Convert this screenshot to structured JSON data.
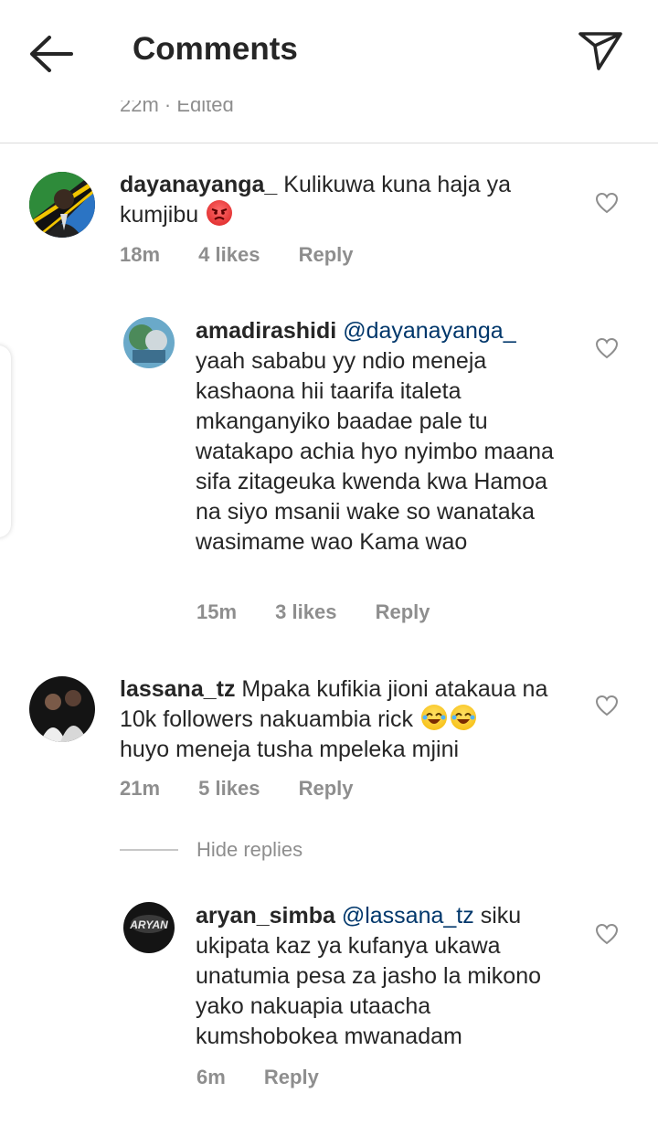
{
  "header": {
    "title": "Comments"
  },
  "prev_meta": "22m · Edited",
  "comments": [
    {
      "username": "dayanayanga_",
      "text": "Kulikuwa kuna haja ya kumjibu",
      "time": "18m",
      "likes": "4 likes",
      "reply": "Reply"
    },
    {
      "username": "amadirashidi",
      "mention": "@dayanayanga_",
      "text": "yaah  sababu yy ndio meneja kashaona hii taarifa italeta mkanganyiko baadae pale tu watakapo achia hyo nyimbo maana sifa zitageuka kwenda kwa Hamoa na siyo msanii wake so wanataka wasimame wao Kama wao",
      "time": "15m",
      "likes": "3 likes",
      "reply": "Reply"
    },
    {
      "username": "lassana_tz",
      "text": "Mpaka kufikia jioni atakaua na 10k followers nakuambia rick",
      "text2": "huyo meneja tusha mpeleka mjini",
      "time": "21m",
      "likes": "5 likes",
      "reply": "Reply"
    },
    {
      "username": "aryan_simba",
      "mention": "@lassana_tz",
      "text": "siku ukipata kaz ya kufanya ukawa unatumia pesa za jasho la mikono yako nakuapia utaacha kumshobokea mwanadam",
      "time": "6m",
      "reply": "Reply",
      "avatar_text": "ARYAN"
    }
  ],
  "hide_replies": "Hide replies",
  "icons": [
    "back-arrow-icon",
    "send-icon",
    "heart-icon",
    "angry-emoji",
    "laughing-emoji"
  ],
  "colors": {
    "text": "#262626",
    "secondary": "#8e8e8e",
    "mention": "#00376b",
    "divider": "#dbdbdb"
  }
}
